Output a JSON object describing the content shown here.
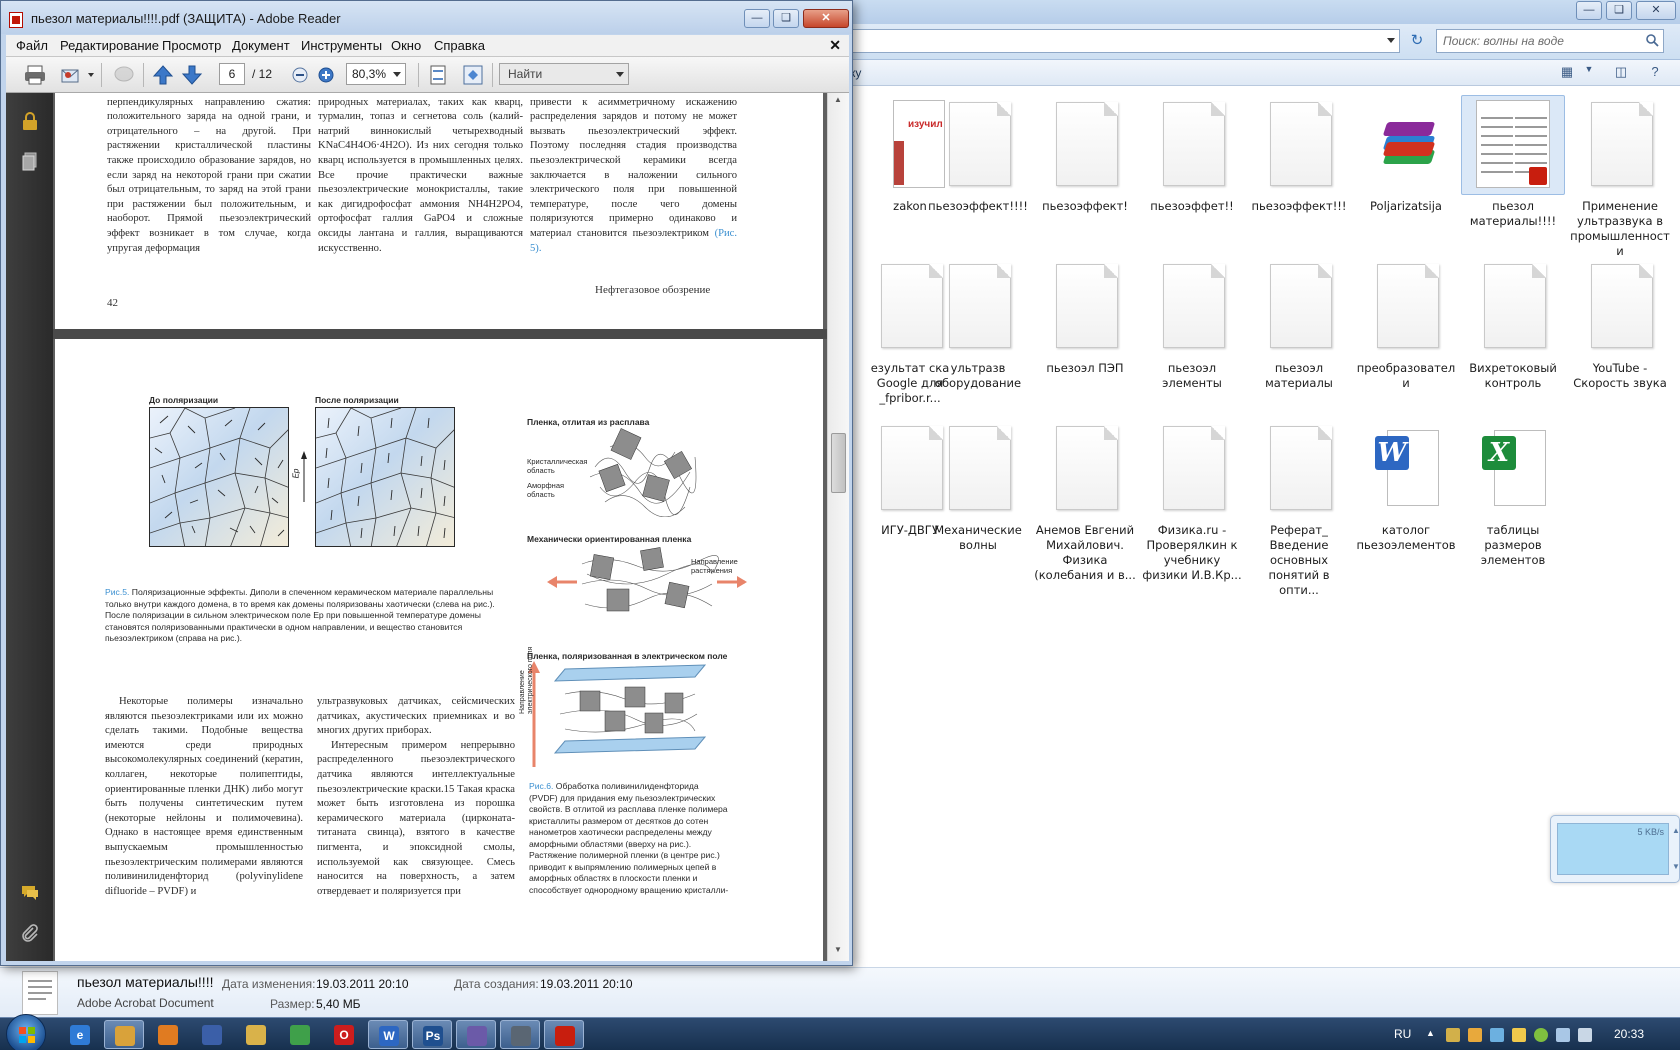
{
  "explorer": {
    "search_placeholder": "Поиск: волны на воде",
    "crumb": "ку",
    "files": [
      {
        "label": "zakon",
        "kind": "zakon"
      },
      {
        "label": "пьезоэффект!!!!",
        "kind": "page"
      },
      {
        "label": "пьезоэффект!",
        "kind": "page"
      },
      {
        "label": "пьезоэффет!!",
        "kind": "page"
      },
      {
        "label": "пьезоэффект!!!",
        "kind": "page"
      },
      {
        "label": "Poljarizatsija",
        "kind": "rar"
      },
      {
        "label": "пьезол материалы!!!!",
        "kind": "pdf",
        "selected": true
      },
      {
        "label": "Применение ультразвука в промышленности",
        "kind": "page"
      },
      {
        "label": "езультат ска Google для _fpribor.r...",
        "kind": "page"
      },
      {
        "label": "ультразв оборудование",
        "kind": "page"
      },
      {
        "label": "пьезоэл ПЭП",
        "kind": "page"
      },
      {
        "label": "пьезоэл элементы",
        "kind": "page"
      },
      {
        "label": "пьезоэл материалы",
        "kind": "page"
      },
      {
        "label": "преобразователи",
        "kind": "page"
      },
      {
        "label": "Вихретоковый контроль",
        "kind": "page"
      },
      {
        "label": "YouTube - Скорость звука",
        "kind": "page"
      },
      {
        "label": "ИГУ-ДВГУ",
        "kind": "page"
      },
      {
        "label": "Механические волны",
        "kind": "page"
      },
      {
        "label": "Анемов Евгений Михайлович. Физика (колебания и в...",
        "kind": "page"
      },
      {
        "label": "Физика.ru - Проверялкин к учебнику физики И.В.Кр...",
        "kind": "page"
      },
      {
        "label": "Реферат_ Введение основных понятий в опти...",
        "kind": "page"
      },
      {
        "label": "католог пьезоэлементов",
        "kind": "word"
      },
      {
        "label": "таблицы размеров элементов",
        "kind": "excel"
      }
    ],
    "details": {
      "name": "пьезол материалы!!!!",
      "type": "Adobe Acrobat Document",
      "modified_label": "Дата изменения:",
      "modified_value": "19.03.2011 20:10",
      "created_label": "Дата создания:",
      "created_value": "19.03.2011 20:10",
      "size_label": "Размер:",
      "size_value": "5,40 МБ"
    },
    "net_widget": {
      "speed": "5 KB/s"
    },
    "zakon_badge": "изучил"
  },
  "reader": {
    "title": "пьезол материалы!!!!.pdf (ЗАЩИТА) - Adobe Reader",
    "menu": [
      "Файл",
      "Редактирование",
      "Просмотр",
      "Документ",
      "Инструменты",
      "Окно",
      "Справка"
    ],
    "toolbar": {
      "page": "6",
      "total": "/ 12",
      "zoom": "80,3%",
      "find": "Найти"
    },
    "page_top": {
      "col1": "электрических зарядов на гранях, перпендикулярных направлению сжатия: положительного заряда на одной грани, и отрицательного – на другой. При растяжении кристаллической пластины также происходило образование зарядов, но если заряд на некоторой грани при сжатии был отрицательным, то заряд на этой грани при растяжении был положительным, и наоборот. Прямой пьезоэлектрический эффект возникает в том случае, когда упругая деформация",
      "col2": "открыли пьезоэлектрический эффект в природных материалах, таких как кварц, турмалин, топаз и сегнетова соль (калий-натрий виннокислый четырехводный KNaC4H4O6·4H2O). Из них сегодня только кварц используется в промышленных целях. Все прочие практически важные пьезоэлектрические монокристаллы, такие как дигидрофосфат аммония NH4H2PO4, ортофосфат галлия GaPO4 и сложные оксиды лантана и галлия, выращиваются искусственно.",
      "col3": "чески поляризованных диполей не может привести к асимметричному искажению распределения зарядов и потому не может вызвать пьезоэлектрический эффект. Поэтому последняя стадия производства пьезоэлектрической керамики всегда заключается в наложении сильного электрического поля при повышенной температуре, после чего домены поляризуются примерно одинаково и материал становится пьезоэлектриком",
      "col3_ref": "(Рис. 5).",
      "page_number": "42",
      "journal": "Нефтегазовое обозрение"
    },
    "page_bottom": {
      "fig5_left_title": "До поляризации",
      "fig5_right_title": "После поляризации",
      "fig5_field_label": "Ep",
      "fig5_caption_lead": "Рис.5.",
      "fig5_caption": "Поляризационные эффекты. Диполи в спеченном керамическом материале параллельны только внутри каждого домена, в то время как домены поляризованы хаотически (слева на рис.). После поляризации в сильном электрическом поле Ep при повышенной температуре домены становятся поляризованными практически в одном направлении, и вещество становится пьезоэлектриком (справа на рис.).",
      "fig6_title_1": "Пленка, отлитая из расплава",
      "fig6_label_crystal": "Кристаллическая область",
      "fig6_label_amorph": "Аморфная область",
      "fig6_title_2": "Механически ориентированная пленка",
      "fig6_label_stretch": "Направление растяжения",
      "fig6_title_3": "Пленка, поляризованная в электрическом поле",
      "fig6_label_field": "Направление электрического поля",
      "fig6_caption_lead": "Рис.6.",
      "fig6_caption": "Обработка поливинилиденфторида (PVDF) для придания ему пьезоэлектрических свойств. В отлитой из расплава пленке полимера кристаллиты размером от десятков до сотен нанометров хаотически распределены между аморфными областями (вверху на рис.). Растяжение полимерной пленки (в центре рис.) приводит к выпрямлению полимерных цепей в аморфных областях в плоскости пленки и способствует однородному вращению кристалли-",
      "col1": "Некоторые полимеры изначально являются пьезоэлектриками или их можно сделать такими. Подобные вещества имеются среди природных высокомолекулярных соединений (кератин, коллаген, некоторые полипептиды, ориентированные пленки ДНК) либо могут быть получены синтетическим путем (некоторые нейлоны и полимочевина). Однако в настоящее время единственным выпускаемым промышленностью пьезоэлектрическим полимерами являются поливинилиденфторид (polyvinylidene difluoride – PVDF) и",
      "col2a": "ультразвуковых датчиках, сейсмических датчиках, акустических приемниках и во многих других приборах.",
      "col2b": "Интересным примером непрерывно распределенного пьезоэлектрического датчика являются интеллектуальные пьезоэлектрические краски.15 Такая краска может быть изготовлена из порошка керамического материала (цирконата-титаната свинца), взятого в качестве пигмента, и эпоксидной смолы, используемой как связующее. Смесь наносится на поверхность, а затем отвердевает и поляризуется при"
    }
  },
  "taskbar": {
    "lang": "RU",
    "time": "20:33",
    "apps": [
      "ie",
      "explorer",
      "media",
      "save",
      "tools",
      "chrome",
      "opera",
      "word",
      "photoshop",
      "network",
      "camera",
      "adobe-reader"
    ]
  }
}
